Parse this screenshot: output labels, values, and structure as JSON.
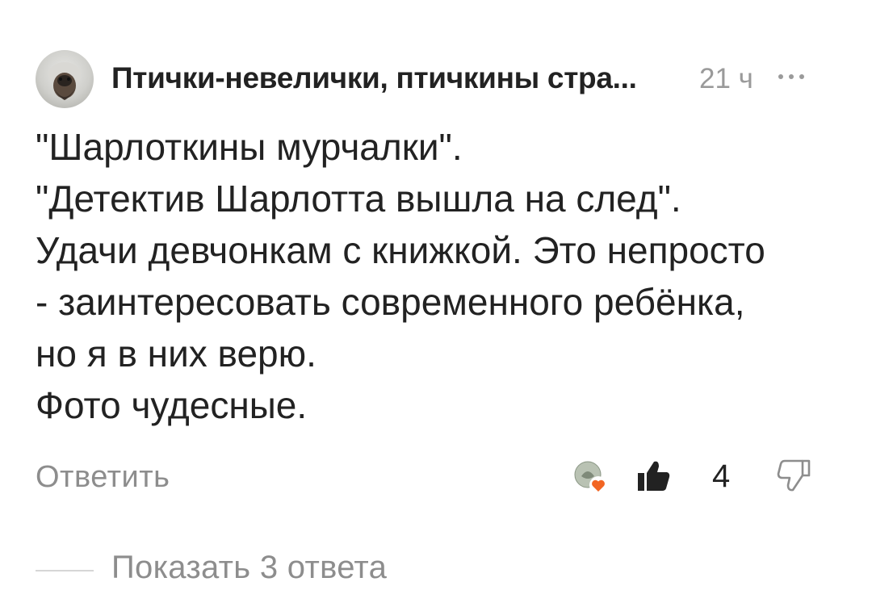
{
  "comment": {
    "author": "Птички-невелички, птичкины стра...",
    "time": "21 ч",
    "more_icon": "ellipsis-icon",
    "lines": [
      "\"Шарлоткины мурчалки\".",
      "\"Детектив Шарлотта вышла на след\".",
      "Удачи девчонкам с книжкой. Это непросто",
      "- заинтересовать современного ребёнка,",
      "но я в них верю.",
      "Фото чудесные."
    ],
    "reply_label": "Ответить",
    "like_count": "4",
    "show_replies_label": "Показать 3 ответа",
    "colors": {
      "text": "#222222",
      "muted": "#8d8d8d",
      "reaction_heart": "#f26522"
    }
  }
}
